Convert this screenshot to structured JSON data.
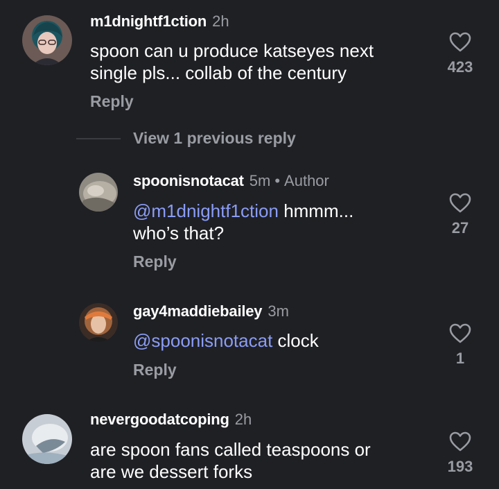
{
  "colors": {
    "background": "#1f2024",
    "text": "#ffffff",
    "muted": "#9a9ca3",
    "mention": "#8a9cf6"
  },
  "thread": {
    "view_previous_label": "View 1 previous reply"
  },
  "comments": [
    {
      "username": "m1dnightf1ction",
      "time": "2h",
      "text_line1": "spoon can u produce katseyes next",
      "text_line2": "single pls... collab of the century",
      "reply_label": "Reply",
      "likes": "423"
    },
    {
      "username": "spoonisnotacat",
      "time": "5m",
      "dot": "•",
      "badge": "Author",
      "mention": "@m1dnightf1ction",
      "text_line1": " hmmm...",
      "text_line2": "who’s that?",
      "reply_label": "Reply",
      "likes": "27"
    },
    {
      "username": "gay4maddiebailey",
      "time": "3m",
      "mention": "@spoonisnotacat",
      "text_line1": " clock",
      "reply_label": "Reply",
      "likes": "1"
    },
    {
      "username": "nevergoodatcoping",
      "time": "2h",
      "text_line1": "are spoon fans called teaspoons or",
      "text_line2": "are we dessert forks",
      "likes": "193"
    }
  ]
}
